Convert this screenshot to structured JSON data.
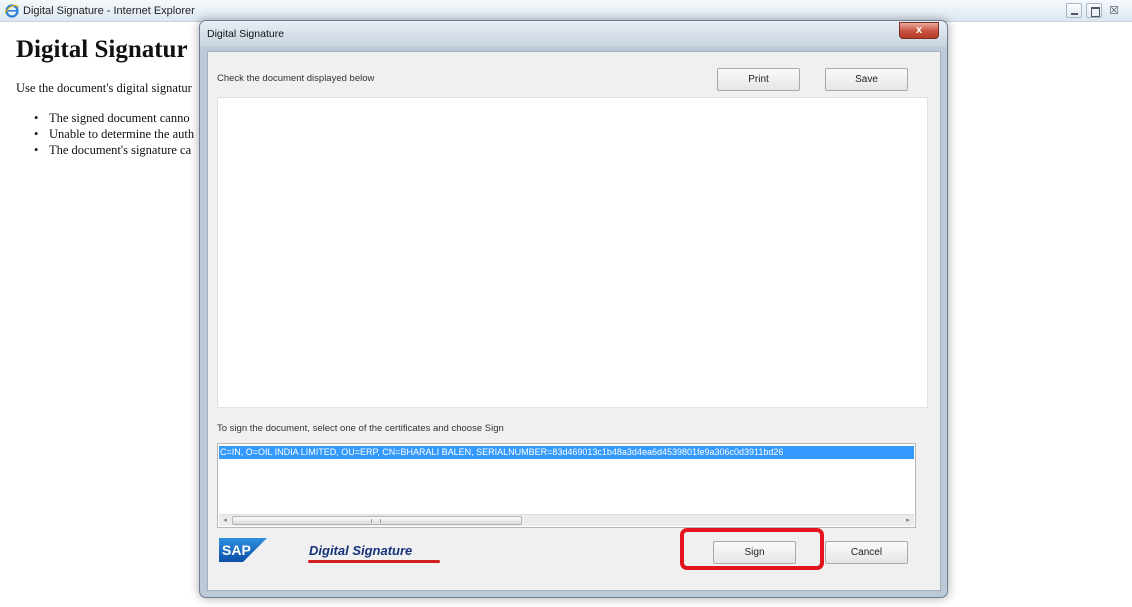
{
  "browser": {
    "title": "Digital Signature - Internet Explorer",
    "close_glyph": "☒"
  },
  "page": {
    "heading": "Digital Signatur",
    "intro": "Use the document's digital signatur",
    "bullets": [
      "The signed document canno",
      "Unable to determine the auth",
      "The document's signature ca"
    ]
  },
  "dialog": {
    "title": "Digital Signature",
    "close_glyph": "x",
    "check_label": "Check the document displayed below",
    "print_label": "Print",
    "save_label": "Save",
    "sign_instruction": "To sign the document, select one of the certificates and choose Sign",
    "certificates": [
      "C=IN, O=OIL INDIA LIMITED, OU=ERP, CN=BHARALI BALEN, SERIALNUMBER=83d469013c1b48a3d4ea6d4539801fe9a306c0d3911bd26"
    ],
    "scroll_left": "◂",
    "scroll_right": "▸",
    "logo_text": "SAP",
    "product_name": "Digital Signature",
    "sign_label": "Sign",
    "cancel_label": "Cancel"
  },
  "colors": {
    "selection": "#3399ff",
    "highlight": "#e3141e",
    "sap_blue": "#16317a"
  }
}
